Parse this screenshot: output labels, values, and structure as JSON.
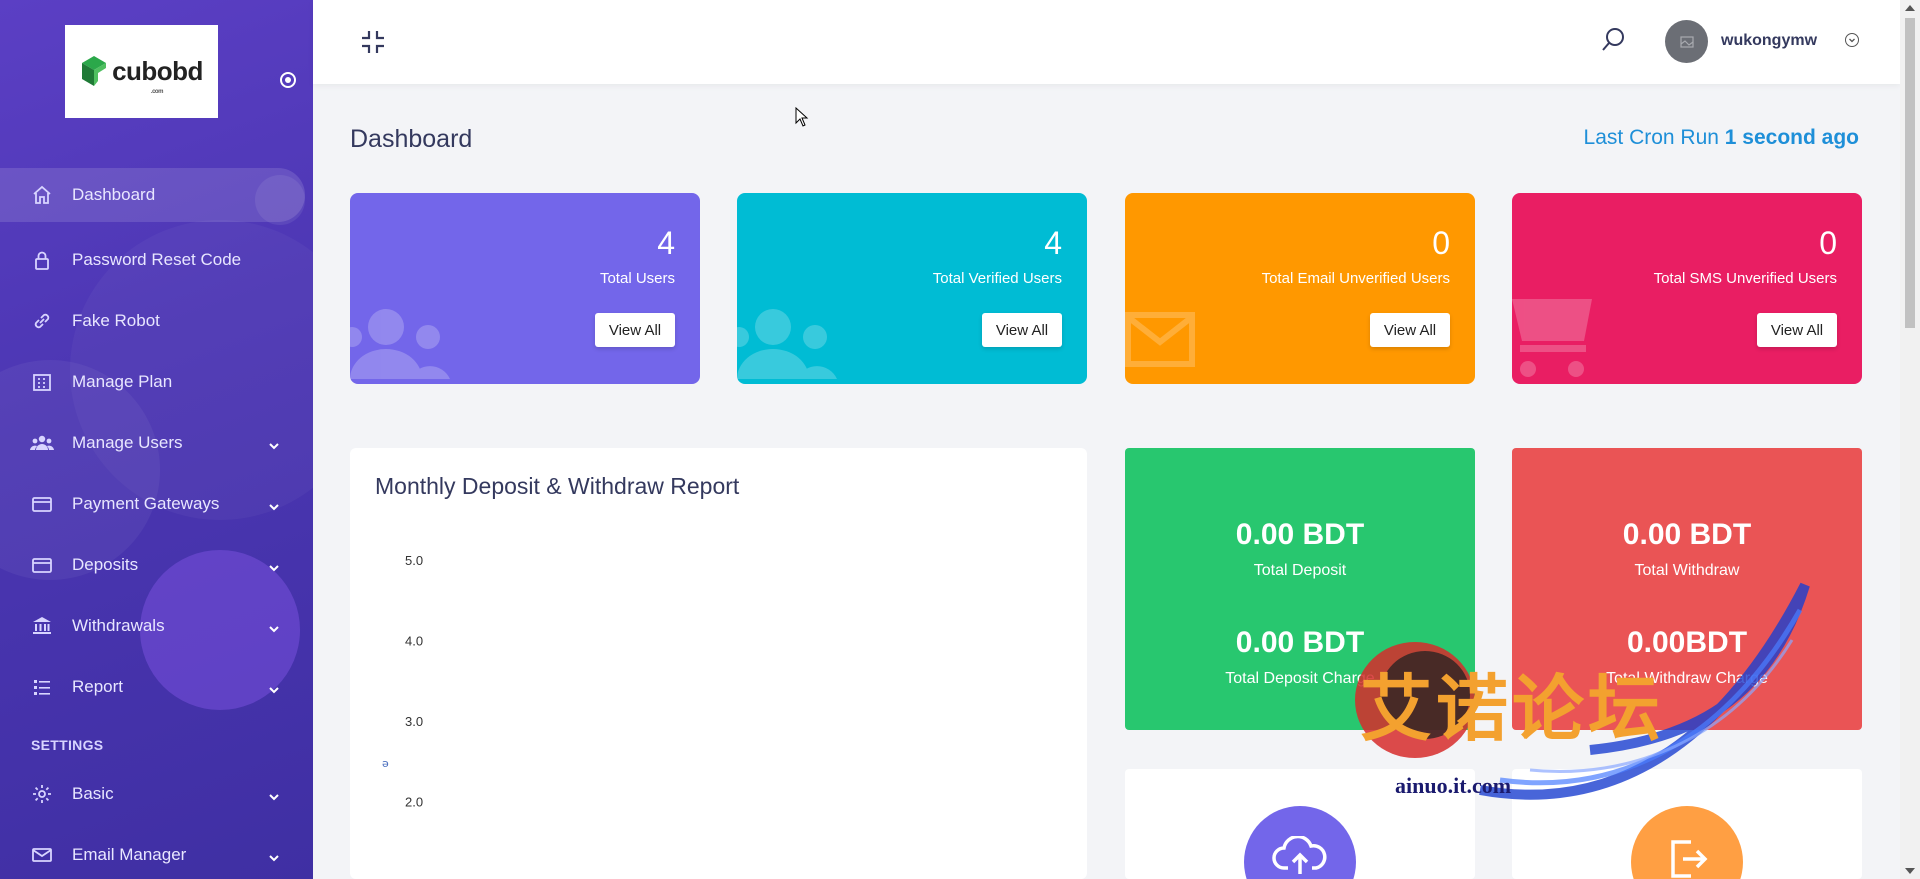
{
  "brand": {
    "logo_text": "cubobd",
    "logo_sub": ".com"
  },
  "sidebar": {
    "items": [
      {
        "label": "Dashboard",
        "icon": "home-icon",
        "active": true,
        "has_submenu": false
      },
      {
        "label": "Password Reset Code",
        "icon": "lock-icon",
        "has_submenu": false
      },
      {
        "label": "Fake Robot",
        "icon": "link-icon",
        "has_submenu": false
      },
      {
        "label": "Manage Plan",
        "icon": "building-icon",
        "has_submenu": false
      },
      {
        "label": "Manage Users",
        "icon": "users-icon",
        "has_submenu": true
      },
      {
        "label": "Payment Gateways",
        "icon": "credit-card-icon",
        "has_submenu": true
      },
      {
        "label": "Deposits",
        "icon": "wallet-icon",
        "has_submenu": true
      },
      {
        "label": "Withdrawals",
        "icon": "bank-icon",
        "has_submenu": true
      },
      {
        "label": "Report",
        "icon": "list-icon",
        "has_submenu": true
      }
    ],
    "settings_heading": "SETTINGS",
    "settings_items": [
      {
        "label": "Basic",
        "icon": "gear-icon",
        "has_submenu": true
      },
      {
        "label": "Email Manager",
        "icon": "envelope-icon",
        "has_submenu": true
      }
    ]
  },
  "topbar": {
    "username": "wukongymw"
  },
  "header": {
    "title": "Dashboard",
    "cron_label": "Last Cron Run",
    "cron_value": "1 second ago"
  },
  "stats": [
    {
      "value": "4",
      "label": "Total Users",
      "button": "View All",
      "color": "#7366ea",
      "icon": "users-icon"
    },
    {
      "value": "4",
      "label": "Total Verified Users",
      "button": "View All",
      "color": "#00bcd4",
      "icon": "users-icon"
    },
    {
      "value": "0",
      "label": "Total Email Unverified Users",
      "button": "View All",
      "color": "#ff9800",
      "icon": "envelope-icon"
    },
    {
      "value": "0",
      "label": "Total SMS Unverified Users",
      "button": "View All",
      "color": "#e91e63",
      "icon": "cart-icon"
    }
  ],
  "chart": {
    "title": "Monthly Deposit & Withdraw Report"
  },
  "chart_data": {
    "type": "bar",
    "title": "Monthly Deposit & Withdraw Report",
    "yticks": [
      "5.0",
      "4.0",
      "3.0",
      "2.0"
    ],
    "ylabel": "ə",
    "ylim": [
      0,
      5
    ],
    "categories": [],
    "series": []
  },
  "money": [
    {
      "amount": "0.00 BDT",
      "caption": "Total Deposit",
      "amount2": "0.00 BDT",
      "caption2": "Total Deposit Charge",
      "color": "#28c76f"
    },
    {
      "amount": "0.00 BDT",
      "caption": "Total Withdraw",
      "amount2": "0.00BDT",
      "caption2": "Total Withdraw Charge",
      "color": "#ea5455"
    }
  ],
  "bottom_cards": [
    {
      "icon": "cloud-upload-icon",
      "color": "#7366ea"
    },
    {
      "icon": "sign-out-icon",
      "color": "#ff9f43"
    }
  ],
  "watermark": {
    "text": "艾诺论坛",
    "url": "ainuo.it.com"
  }
}
